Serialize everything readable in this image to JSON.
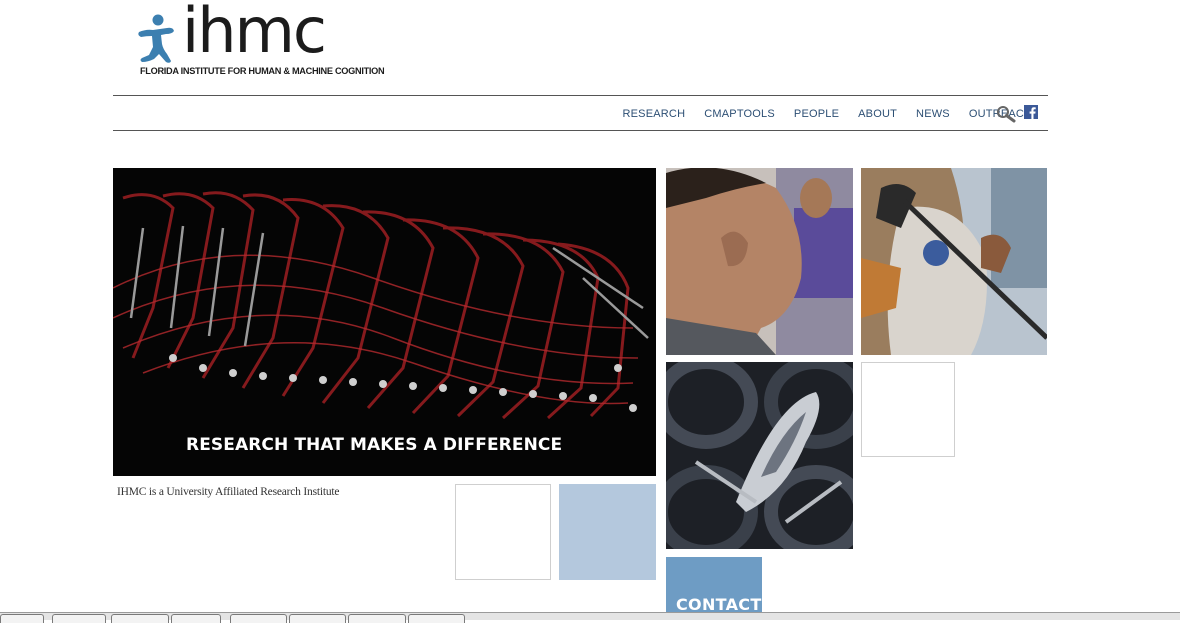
{
  "logo": {
    "word": "ihmc",
    "subtitle": "FLORIDA INSTITUTE FOR HUMAN & MACHINE COGNITION",
    "figure_color": "#3c7fb0"
  },
  "nav": {
    "items": [
      "RESEARCH",
      "CMAPTOOLS",
      "PEOPLE",
      "ABOUT",
      "NEWS",
      "OUTREACH"
    ],
    "search_icon": "search-icon",
    "facebook_icon": "facebook-icon",
    "link_color": "#2d4f74"
  },
  "hero": {
    "caption": "RESEARCH THAT MAKES A DIFFERENCE"
  },
  "tagline": "IHMC is a University Affiliated Research Institute",
  "tiles": {
    "contact_label": "CONTACT",
    "blue_color": "#b4c8dd",
    "contact_color": "#6e9cc4"
  }
}
